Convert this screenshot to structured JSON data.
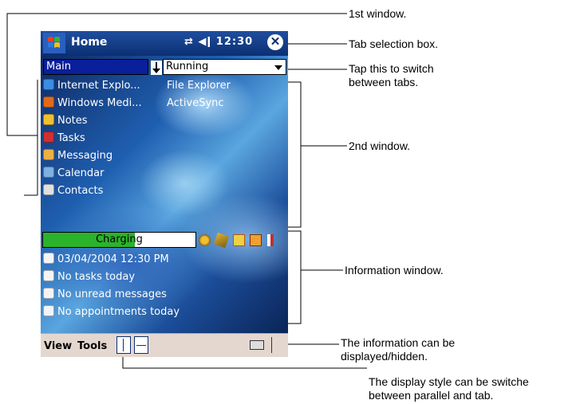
{
  "titlebar": {
    "title": "Home",
    "tray_text": "⇄ ◀ǀ 12:30",
    "close_label": "✕"
  },
  "tabs": {
    "main_label": "Main",
    "running_label": "Running"
  },
  "main_list": [
    {
      "label": "Internet Explo...",
      "icon": "internet-explorer-icon",
      "color": "#3a8de0"
    },
    {
      "label": "Windows Medi...",
      "icon": "windows-media-icon",
      "color": "#e06a1a"
    },
    {
      "label": "Notes",
      "icon": "notes-icon",
      "color": "#f0c030"
    },
    {
      "label": "Tasks",
      "icon": "tasks-icon",
      "color": "#d03030"
    },
    {
      "label": "Messaging",
      "icon": "messaging-icon",
      "color": "#f0b040"
    },
    {
      "label": "Calendar",
      "icon": "calendar-icon",
      "color": "#7fb0e0"
    },
    {
      "label": "Contacts",
      "icon": "contacts-icon",
      "color": "#e0e0e0"
    }
  ],
  "running_list": [
    {
      "label": "File Explorer"
    },
    {
      "label": "ActiveSync"
    }
  ],
  "info": {
    "charging_label": "Charging",
    "charging_level": 0.6,
    "items": [
      {
        "label": "03/04/2004 12:30 PM",
        "icon": "clock-icon"
      },
      {
        "label": "No tasks today",
        "icon": "tasks-icon"
      },
      {
        "label": "No unread messages",
        "icon": "envelope-icon"
      },
      {
        "label": "No appointments today",
        "icon": "calendar-icon"
      }
    ]
  },
  "menubar": {
    "view_label": "View",
    "tools_label": "Tools"
  },
  "callouts": {
    "first_window": "1st window.",
    "tab_selection": "Tab selection box.",
    "tap_switch_1": "Tap this to switch",
    "tap_switch_2": "between tabs.",
    "second_window": "2nd window.",
    "info_window": "Information window.",
    "info_toggle_1": "The information can be",
    "info_toggle_2": "displayed/hidden.",
    "display_style_1": "The display style can be switche",
    "display_style_2": "between parallel and tab."
  },
  "colors": {
    "titlebar": "#0b2f74",
    "main_tab": "#0a1f9a",
    "charge_fill": "#2bb32b",
    "menubar": "#e4d7cf"
  }
}
